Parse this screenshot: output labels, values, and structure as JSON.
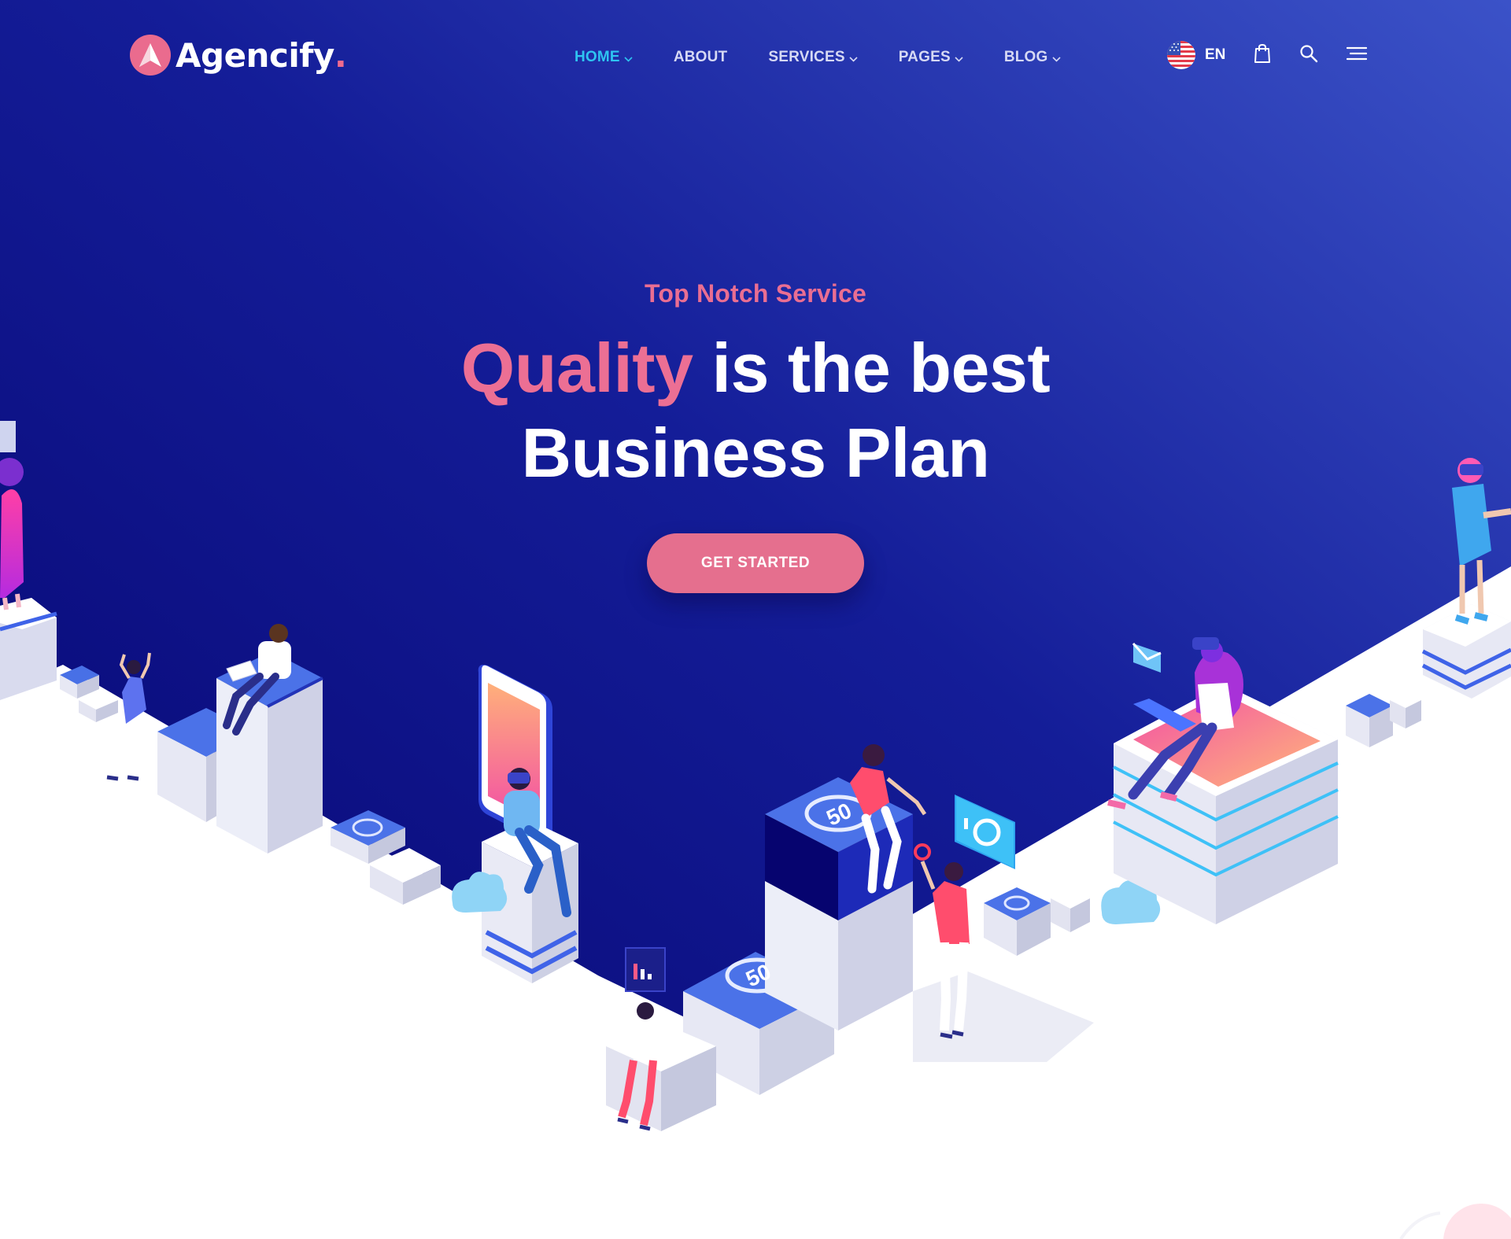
{
  "brand": {
    "name": "Agencify",
    "dot": ".",
    "logo_icon": "paper-plane-icon",
    "accent_color": "#ea6b8e"
  },
  "nav": {
    "items": [
      {
        "label": "HOME",
        "dropdown": true,
        "active": true
      },
      {
        "label": "ABOUT",
        "dropdown": false,
        "active": false
      },
      {
        "label": "SERVICES",
        "dropdown": true,
        "active": false
      },
      {
        "label": "PAGES",
        "dropdown": true,
        "active": false
      },
      {
        "label": "BLOG",
        "dropdown": true,
        "active": false
      }
    ],
    "active_color": "#2ec4f1"
  },
  "tools": {
    "language": {
      "code": "EN",
      "flag_icon": "us-flag-icon"
    },
    "cart_icon": "shopping-bag-icon",
    "search_icon": "search-icon",
    "menu_icon": "hamburger-menu-icon"
  },
  "hero": {
    "kicker": "Top Notch Service",
    "headline_accent": "Quality",
    "headline_rest": " is the best",
    "headline_line2": "Business Plan",
    "cta_label": "GET STARTED",
    "illustration": {
      "cube_labels": [
        "50",
        "50",
        "50"
      ]
    }
  },
  "colors": {
    "bg_dark": "#05036e",
    "bg_light": "#3449c4",
    "pink": "#e56f8e",
    "floor": "#ffffff"
  }
}
